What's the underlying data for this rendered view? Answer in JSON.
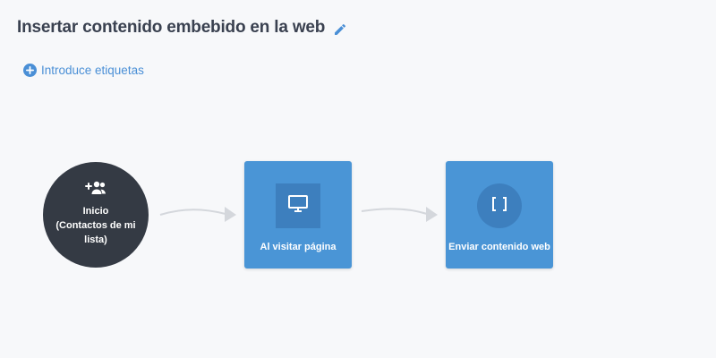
{
  "header": {
    "title": "Insertar contenido embebido en la web",
    "edit_icon": "pencil-icon"
  },
  "tags": {
    "label": "Introduce etiquetas",
    "icon": "plus-circle-icon"
  },
  "flow": {
    "start": {
      "icon": "add-group-icon",
      "label_lines": [
        "Inicio",
        "(Contactos de mi",
        "lista)"
      ]
    },
    "nodes": [
      {
        "id": "visit",
        "icon": "monitor-icon",
        "label": "Al visitar página"
      },
      {
        "id": "send",
        "icon": "brackets-icon",
        "label": "Enviar contenido web"
      }
    ]
  },
  "colors": {
    "title": "#3a4150",
    "accent": "#4a8fd6",
    "start_node": "#343a44",
    "action_node": "#4a95d6",
    "action_icon_bg": "#3d7fbe",
    "connector": "#d4d7dc"
  }
}
